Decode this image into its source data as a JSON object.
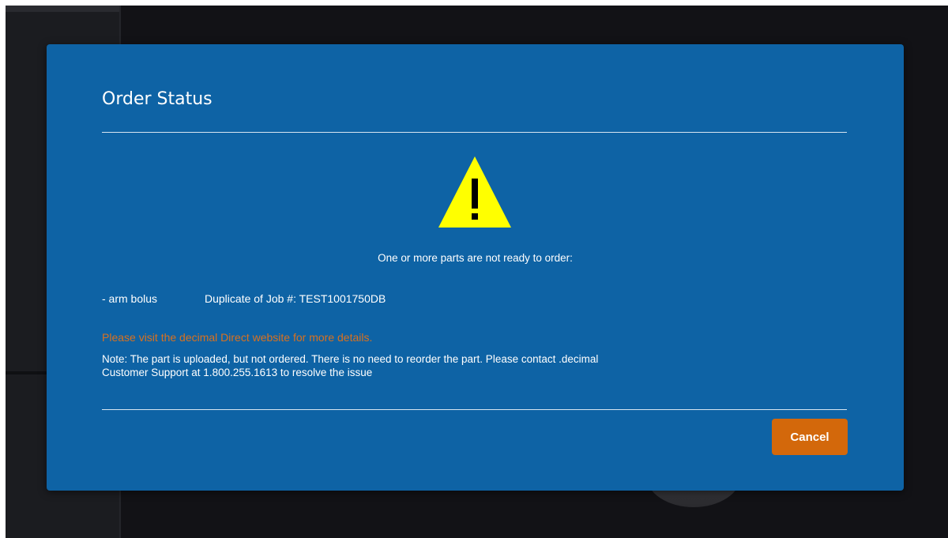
{
  "modal": {
    "title": "Order Status",
    "icon": "warning-triangle-icon",
    "message": "One or more parts are not ready to order:",
    "part": {
      "name": "- arm bolus",
      "detail": "Duplicate of Job #: TEST1001750DB"
    },
    "visit_link": "Please visit the decimal Direct website for more details.",
    "note_line1": "Note: The part is uploaded, but not ordered. There is no need to reorder the part. Please contact .decimal",
    "note_line2": "Customer Support at  1.800.255.1613 to resolve the issue",
    "cancel_label": "Cancel"
  },
  "colors": {
    "modal_bg": "#0e63a5",
    "accent_orange": "#d3680b",
    "link_orange": "#d9711f",
    "warning_yellow": "#ffff00"
  }
}
